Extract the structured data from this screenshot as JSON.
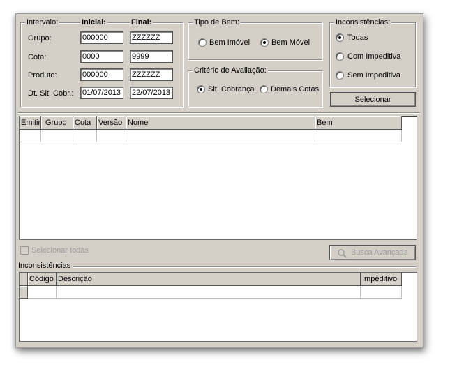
{
  "intervalo": {
    "title": "Intervalo:",
    "col_inicial": "Inicial:",
    "col_final": "Final:",
    "rows": [
      {
        "label": "Grupo:",
        "inicial": "000000",
        "final": "ZZZZZZ"
      },
      {
        "label": "Cota:",
        "inicial": "0000",
        "final": "9999"
      },
      {
        "label": "Produto:",
        "inicial": "000000",
        "final": "ZZZZZZ"
      },
      {
        "label": "Dt. Sit. Cobr.:",
        "inicial": "01/07/2013",
        "final": "22/07/2013"
      }
    ]
  },
  "tipo_bem": {
    "title": "Tipo de Bem:",
    "options": [
      "Bem Imóvel",
      "Bem Móvel"
    ],
    "selected": "Bem Móvel"
  },
  "criterio": {
    "title": "Critério de Avaliação:",
    "options": [
      "Sit. Cobrança",
      "Demais Cotas"
    ],
    "selected": "Sit. Cobrança"
  },
  "inconsistencias_filter": {
    "title": "Inconsistências:",
    "options": [
      "Todas",
      "Com Impeditiva",
      "Sem Impeditiva"
    ],
    "selected": "Todas"
  },
  "selecionar_button": "Selecionar",
  "main_grid": {
    "columns": [
      "Emitir",
      "Grupo",
      "Cota",
      "Versão",
      "Nome",
      "Bem"
    ]
  },
  "selecionar_todas": "Selecionar todas",
  "busca_avancada": "Busca Avançada",
  "inconsistencias_section": {
    "title": "Inconsistências",
    "columns": [
      "Código",
      "Descrição",
      "Impeditivo"
    ]
  }
}
